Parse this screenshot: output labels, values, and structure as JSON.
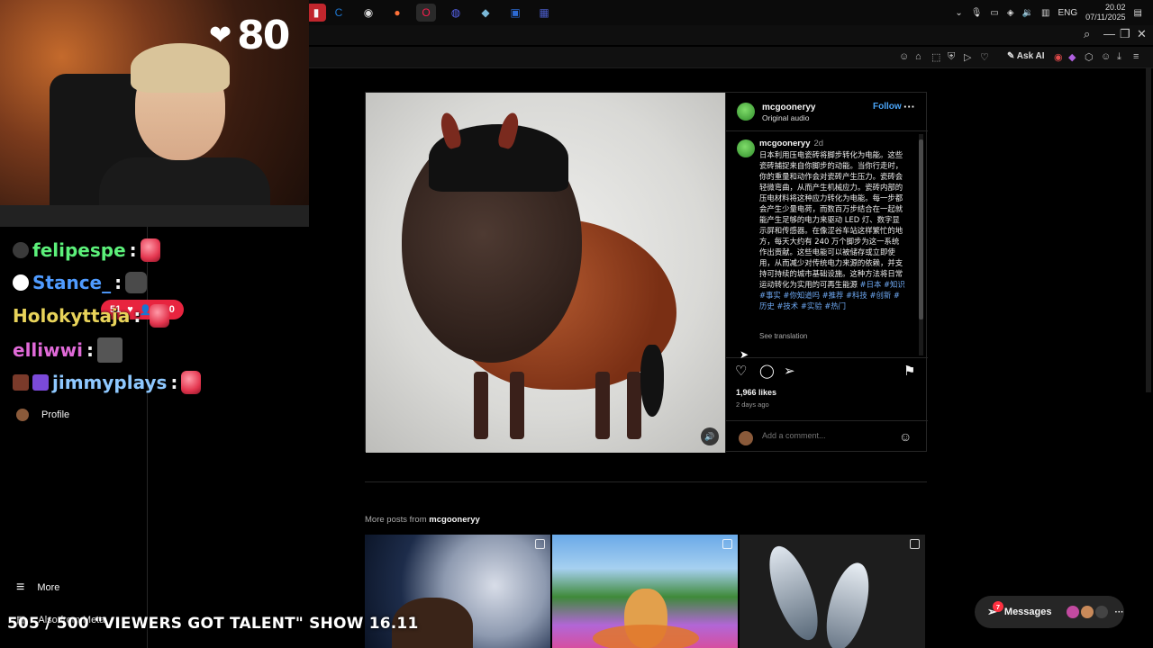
{
  "taskbar": {
    "lang": "ENG",
    "time": "20.02",
    "date": "07/11/2025",
    "apps": [
      {
        "icon": "pdf-icon",
        "color": "#c0262d"
      },
      {
        "icon": "ccleaner-icon",
        "color": "#1e77d1"
      },
      {
        "icon": "obs-icon",
        "color": "#333"
      },
      {
        "icon": "firefox-icon",
        "color": "#ff7139"
      },
      {
        "icon": "opera-gx-icon",
        "color": "#fa1e4e"
      },
      {
        "icon": "discord-icon",
        "color": "#5865f2"
      },
      {
        "icon": "chat-app-icon",
        "color": "#7ab8d8"
      },
      {
        "icon": "network-app-icon",
        "color": "#2d6bd4"
      },
      {
        "icon": "grid-app-icon",
        "color": "#4a5cc9"
      }
    ]
  },
  "browser": {
    "ask_ai": "Ask AI"
  },
  "overlay": {
    "heart_count": "80",
    "chat": [
      {
        "user": "felipespe",
        "color": "#5cf07a"
      },
      {
        "user": "Stance_",
        "color": "#4f9bff"
      },
      {
        "user": "Holokyttaja",
        "color": "#e8d35a"
      },
      {
        "user": "elliwwi",
        "color": "#e06ad8"
      },
      {
        "user": "jimmyplays",
        "color": "#8ec8ff"
      }
    ],
    "pill": {
      "viewers": "51",
      "likes": "100"
    },
    "bottom_text": "505 / 500 \"VIEWERS GOT TALENT\" SHOW 16.11"
  },
  "sidebar": {
    "profile_label": "Profile",
    "more_label": "More",
    "also_from_meta": "Also from Meta"
  },
  "post": {
    "username": "mcgooneryy",
    "audio": "Original audio",
    "follow_label": "Follow",
    "caption_user": "mcgooneryy",
    "caption_time": "2d",
    "caption_text": "日本利用压电瓷砖将脚步转化为电能。这些瓷砖捕捉来自你脚步的动能。当你行走时，你的重量和动作会对瓷砖产生压力。瓷砖会轻微弯曲，从而产生机械应力。瓷砖内部的压电材料将这种应力转化为电能。每一步都会产生少量电荷，而数百万步结合在一起就能产生足够的电力来驱动 LED 灯、数字显示屏和传感器。在像涩谷车站这样繁忙的地方，每天大约有 240 万个脚步为这一系统作出贡献。这些电能可以被储存或立即使用，从而减少对传统电力来源的依赖，并支持可持续的城市基础设施。这种方法将日常运动转化为实用的可再生能源",
    "caption_tags": "#日本 #知识 #事实 #你知道吗 #推荐 #科技 #创新 #历史 #技术 #实验 #热门",
    "see_translation": "See translation",
    "likes": "1,966 likes",
    "ago": "2 days ago",
    "comment_placeholder": "Add a comment..."
  },
  "more_posts": {
    "prefix": "More posts from ",
    "user": "mcgooneryy"
  },
  "messages": {
    "label": "Messages",
    "badge": "7"
  }
}
